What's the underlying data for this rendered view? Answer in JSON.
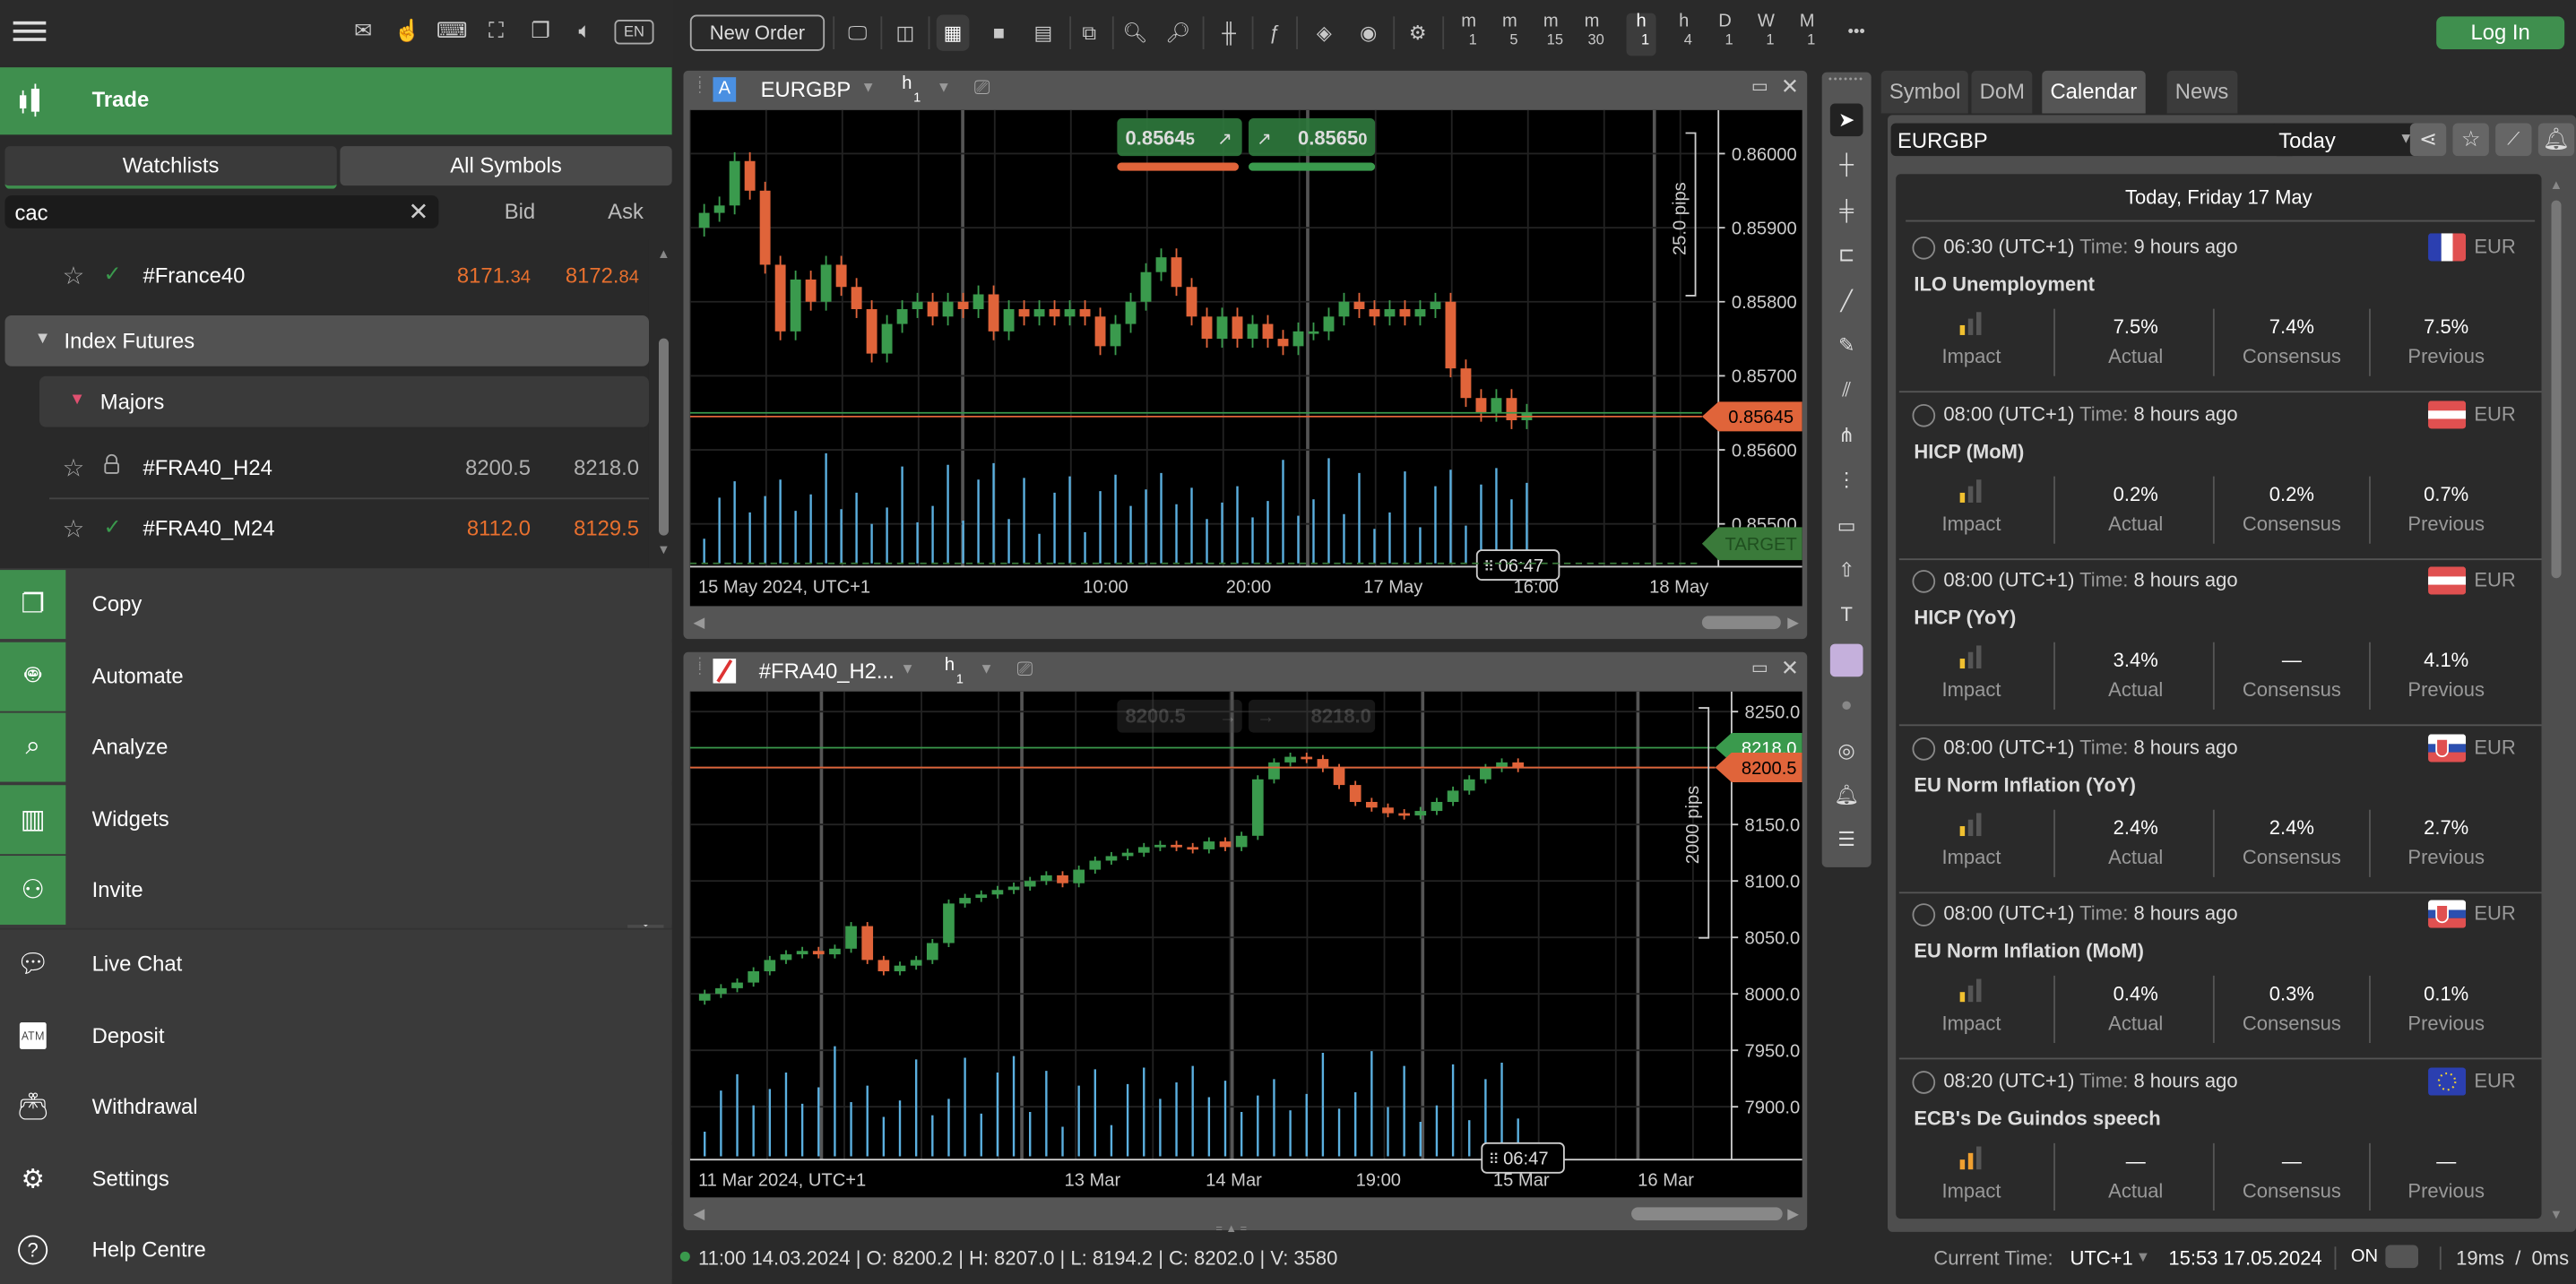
{
  "top_icons": [
    "mail-icon",
    "gesture-settings-icon",
    "keyboard-icon",
    "fullscreen-icon",
    "windows-icon",
    "sound-icon",
    "language-icon"
  ],
  "language": "EN",
  "sidebar": {
    "trade_label": "Trade",
    "tabs": [
      {
        "label": "Watchlists",
        "active": true
      },
      {
        "label": "All Symbols",
        "active": false
      }
    ],
    "search_value": "cac",
    "col_bid": "Bid",
    "col_ask": "Ask",
    "rows": [
      {
        "symbol": "#France40",
        "status": "check",
        "bid_main": "8171.",
        "bid_small": "34",
        "ask_main": "8172.",
        "ask_small": "84",
        "color": "#e8702e"
      }
    ],
    "group_label": "Index Futures",
    "subgroup_label": "Majors",
    "sub_rows": [
      {
        "symbol": "#FRA40_H24",
        "status": "lock",
        "bid": "8200.5",
        "ask": "8218.0",
        "color": "#b0b0b0"
      },
      {
        "symbol": "#FRA40_M24",
        "status": "check",
        "bid": "8112.0",
        "ask": "8129.5",
        "color": "#e8702e"
      }
    ],
    "menu_green": [
      {
        "label": "Copy",
        "icon": "copy-icon"
      },
      {
        "label": "Automate",
        "icon": "robot-icon"
      },
      {
        "label": "Analyze",
        "icon": "analyze-icon"
      },
      {
        "label": "Widgets",
        "icon": "widgets-icon"
      },
      {
        "label": "Invite",
        "icon": "people-icon"
      }
    ],
    "menu_plain": [
      {
        "label": "Live Chat",
        "icon": "chat-icon"
      },
      {
        "label": "Deposit",
        "icon": "deposit-icon"
      },
      {
        "label": "Withdrawal",
        "icon": "wallet-icon"
      },
      {
        "label": "Settings",
        "icon": "gear-icon"
      },
      {
        "label": "Help Centre",
        "icon": "help-icon"
      }
    ]
  },
  "toolbar": {
    "new_order": "New Order",
    "timeframes": [
      {
        "u": "m",
        "n": "1",
        "active": false
      },
      {
        "u": "m",
        "n": "5",
        "active": false
      },
      {
        "u": "m",
        "n": "15",
        "active": false
      },
      {
        "u": "m",
        "n": "30",
        "active": false
      },
      {
        "u": "h",
        "n": "1",
        "active": true
      },
      {
        "u": "h",
        "n": "4",
        "active": false
      },
      {
        "u": "D",
        "n": "1",
        "active": false
      },
      {
        "u": "W",
        "n": "1",
        "active": false
      },
      {
        "u": "M",
        "n": "1",
        "active": false
      }
    ],
    "more": "•••",
    "login": "Log In"
  },
  "charts": [
    {
      "symbol": "EURGBP",
      "badge": "A",
      "timeframe_u": "h",
      "timeframe_n": "1",
      "sell_price_main": "0.8564",
      "sell_price_small": "5",
      "buy_price_main": "0.8565",
      "buy_price_small": "0",
      "price_axis": [
        "0.86000",
        "0.85900",
        "0.85800",
        "0.85700",
        "0.85600",
        "0.85500"
      ],
      "current_price": "0.85645",
      "target_label": "TARGET",
      "measure_label": "25.0 pips",
      "time_axis": [
        "15 May 2024, UTC+1",
        "10:00",
        "20:00",
        "17 May",
        "16:00",
        "18 May"
      ],
      "countdown": "06:47",
      "y_range": [
        0.8546,
        0.8605
      ]
    },
    {
      "symbol": "#FRA40_H2...",
      "badge": "",
      "timeframe_u": "h",
      "timeframe_n": "1",
      "sell_price": "8200.5",
      "buy_price": "8218.0",
      "price_axis": [
        "8250.0",
        "8200.0",
        "8150.0",
        "8100.0",
        "8050.0",
        "8000.0",
        "7950.0",
        "7900.0"
      ],
      "ask_line": "8218.0",
      "bid_line": "8200.5",
      "measure_label": "2000 pips",
      "time_axis": [
        "11 Mar 2024, UTC+1",
        "13 Mar",
        "14 Mar",
        "19:00",
        "15 Mar",
        "16 Mar"
      ],
      "countdown": "06:47",
      "y_range": [
        7875,
        8262
      ]
    }
  ],
  "chart_data": [
    {
      "type": "candlestick",
      "title": "EURGBP h1",
      "ylim": [
        0.8546,
        0.8605
      ],
      "ytick_labels": [
        "0.86000",
        "0.85900",
        "0.85800",
        "0.85700",
        "0.85600",
        "0.85500"
      ],
      "xtick_labels": [
        "15 May 2024, UTC+1",
        "10:00",
        "20:00",
        "17 May",
        "16:00",
        "18 May"
      ],
      "bid": 0.85645,
      "ask": 0.8565,
      "closes": [
        0.8592,
        0.8593,
        0.8599,
        0.8595,
        0.8585,
        0.8576,
        0.8583,
        0.858,
        0.8585,
        0.8582,
        0.8579,
        0.8573,
        0.8577,
        0.8579,
        0.858,
        0.8578,
        0.858,
        0.8579,
        0.8581,
        0.8576,
        0.8579,
        0.8578,
        0.8579,
        0.8578,
        0.8579,
        0.8578,
        0.8574,
        0.8577,
        0.858,
        0.8584,
        0.8586,
        0.8582,
        0.8578,
        0.8575,
        0.8578,
        0.8575,
        0.8577,
        0.8575,
        0.8574,
        0.8576,
        0.8576,
        0.8578,
        0.858,
        0.8579,
        0.8578,
        0.8579,
        0.8578,
        0.8579,
        0.858,
        0.8571,
        0.8567,
        0.8565,
        0.8567,
        0.8564,
        0.8565
      ]
    },
    {
      "type": "candlestick",
      "title": "#FRA40_H24 h1",
      "ylim": [
        7875,
        8262
      ],
      "ytick_labels": [
        "8250.0",
        "8200.0",
        "8150.0",
        "8100.0",
        "8050.0",
        "8000.0",
        "7950.0",
        "7900.0"
      ],
      "xtick_labels": [
        "11 Mar 2024, UTC+1",
        "13 Mar",
        "14 Mar",
        "19:00",
        "15 Mar",
        "16 Mar"
      ],
      "bid": 8200.5,
      "ask": 8218.0,
      "closes": [
        8000,
        8005,
        8010,
        8020,
        8030,
        8035,
        8038,
        8035,
        8040,
        8060,
        8030,
        8020,
        8025,
        8030,
        8045,
        8080,
        8085,
        8088,
        8092,
        8095,
        8100,
        8105,
        8098,
        8110,
        8118,
        8122,
        8125,
        8130,
        8132,
        8130,
        8128,
        8135,
        8130,
        8140,
        8190,
        8205,
        8210,
        8208,
        8200,
        8185,
        8170,
        8165,
        8160,
        8158,
        8162,
        8170,
        8180,
        8190,
        8200,
        8205,
        8200
      ]
    }
  ],
  "dt_tools": [
    "cursor-icon",
    "crosshair-icon",
    "crosshair-plus-icon",
    "measure-icon",
    "trendline-icon",
    "pencil-icon",
    "andrews-pitchfork-icon",
    "fork-icon",
    "fibonacci-icon",
    "rectangle-icon",
    "arrow-up-icon",
    "text-icon",
    "color-swatch-icon",
    "opacity-icon",
    "camera-icon",
    "alert-bell-icon",
    "templates-icon"
  ],
  "right_panel": {
    "tabs": [
      {
        "label": "Symbol",
        "active": false
      },
      {
        "label": "DoM",
        "active": false
      },
      {
        "label": "Calendar",
        "active": true
      },
      {
        "label": "News",
        "active": false
      }
    ],
    "symbol_select": "EURGBP",
    "period_select": "Today",
    "date_header": "Today, Friday 17 May",
    "time_label": "Time:",
    "col_labels": {
      "impact": "Impact",
      "actual": "Actual",
      "consensus": "Consensus",
      "previous": "Previous"
    },
    "events": [
      {
        "time": "06:30 (UTC+1)",
        "ago": "9 hours ago",
        "flag": "france",
        "currency": "EUR",
        "name": "ILO Unemployment",
        "impact": 1,
        "actual": "7.5%",
        "consensus": "7.4%",
        "previous": "7.5%"
      },
      {
        "time": "08:00 (UTC+1)",
        "ago": "8 hours ago",
        "flag": "austria",
        "currency": "EUR",
        "name": "HICP (MoM)",
        "impact": 1,
        "actual": "0.2%",
        "consensus": "0.2%",
        "previous": "0.7%"
      },
      {
        "time": "08:00 (UTC+1)",
        "ago": "8 hours ago",
        "flag": "austria",
        "currency": "EUR",
        "name": "HICP (YoY)",
        "impact": 1,
        "actual": "3.4%",
        "consensus": "—",
        "previous": "4.1%"
      },
      {
        "time": "08:00 (UTC+1)",
        "ago": "8 hours ago",
        "flag": "slovakia",
        "currency": "EUR",
        "name": "EU Norm Inflation (YoY)",
        "impact": 1,
        "actual": "2.4%",
        "consensus": "2.4%",
        "previous": "2.7%"
      },
      {
        "time": "08:00 (UTC+1)",
        "ago": "8 hours ago",
        "flag": "slovakia",
        "currency": "EUR",
        "name": "EU Norm Inflation (MoM)",
        "impact": 1,
        "actual": "0.4%",
        "consensus": "0.3%",
        "previous": "0.1%"
      },
      {
        "time": "08:20 (UTC+1)",
        "ago": "8 hours ago",
        "flag": "eu",
        "currency": "EUR",
        "name": "ECB's De Guindos speech",
        "impact": 2,
        "actual": "—",
        "consensus": "—",
        "previous": "—"
      }
    ]
  },
  "status_bar": {
    "ohlc": "11:00 14.03.2024 | O: 8200.2 | H: 8207.0 | L: 8194.2 | C: 8202.0 | V: 3580",
    "current_time_label": "Current Time:",
    "timezone": "UTC+1",
    "clock": "15:53 17.05.2024",
    "on_label": "ON",
    "latency": "19ms  /  0ms"
  },
  "colors": {
    "green": "#3f8f4e",
    "orange": "#e0643a",
    "up": "#3a9a4d",
    "down": "#e0643a",
    "volume": "#5bb0e0",
    "impact": "#f0c030",
    "impact_medium": "#f0a030"
  }
}
